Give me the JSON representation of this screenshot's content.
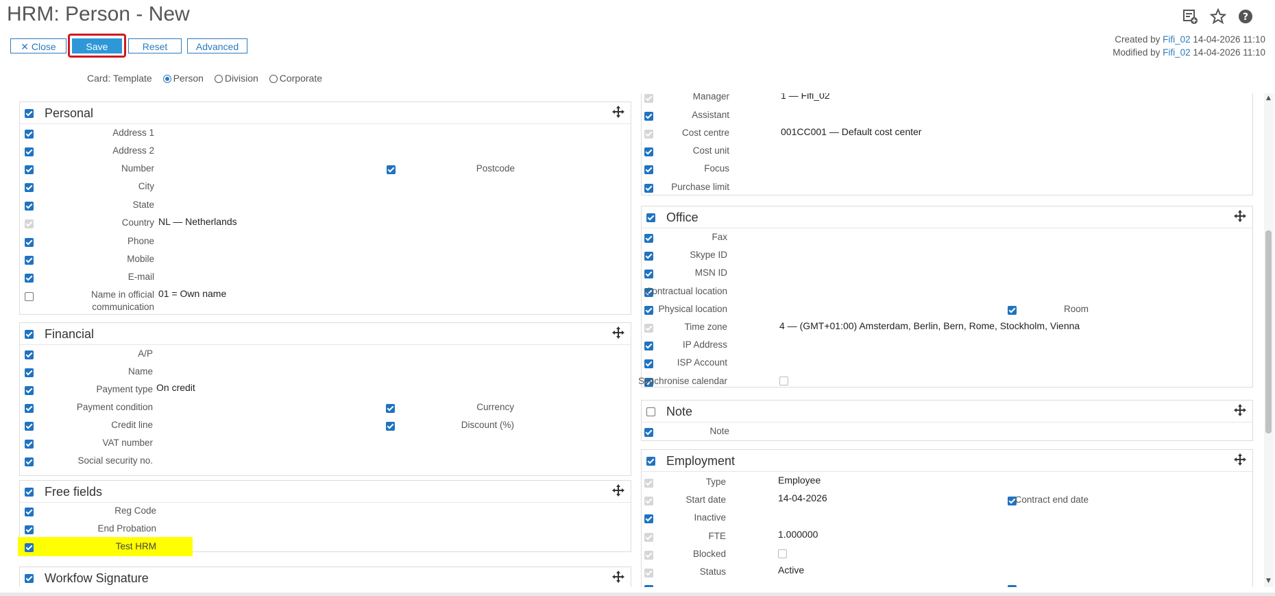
{
  "header": {
    "title": "HRM: Person - New",
    "buttons": {
      "close": "Close",
      "save": "Save",
      "reset": "Reset",
      "advanced": "Advanced"
    },
    "icons": [
      "list-add-icon",
      "star-icon",
      "help-icon"
    ],
    "created_label": "Created by",
    "created_user": "Fifi_02",
    "created_date": "14-04-2026 11:10",
    "modified_label": "Modified by",
    "modified_user": "Fifi_02",
    "modified_date": "14-04-2026 11:10"
  },
  "card": {
    "label": "Card: Template",
    "options": [
      "Person",
      "Division",
      "Corporate"
    ],
    "selected": "Person"
  },
  "left": {
    "personal": {
      "title": "Personal",
      "fields": {
        "address1": "Address 1",
        "address2": "Address 2",
        "number": "Number",
        "postcode": "Postcode",
        "city": "City",
        "state": "State",
        "country": "Country",
        "country_value": "NL — Netherlands",
        "phone": "Phone",
        "mobile": "Mobile",
        "email": "E-mail",
        "official_1": "Name in official",
        "official_2": "communication",
        "official_value": "01 = Own name"
      }
    },
    "financial": {
      "title": "Financial",
      "fields": {
        "ap": "A/P",
        "name": "Name",
        "payment_type": "Payment type",
        "payment_type_value": "On credit",
        "payment_condition": "Payment condition",
        "currency": "Currency",
        "credit_line": "Credit line",
        "discount": "Discount (%)",
        "vat": "VAT number",
        "ssn": "Social security no."
      }
    },
    "free": {
      "title": "Free fields",
      "fields": {
        "reg_code": "Reg Code",
        "end_probation": "End Probation",
        "test_hrm": "Test HRM"
      }
    },
    "workflow": {
      "title": "Workfow Signature"
    }
  },
  "right": {
    "top": {
      "manager": "Manager",
      "manager_value": "1 — Fifi_02",
      "assistant": "Assistant",
      "cost_centre": "Cost centre",
      "cost_centre_value": "001CC001 — Default cost center",
      "cost_unit": "Cost unit",
      "focus": "Focus",
      "purchase_limit": "Purchase limit"
    },
    "office": {
      "title": "Office",
      "fields": {
        "fax": "Fax",
        "skype": "Skype ID",
        "msn": "MSN ID",
        "contractual": "Contractual location",
        "physical": "Physical location",
        "room": "Room",
        "time_zone": "Time zone",
        "time_zone_value": "4 — (GMT+01:00) Amsterdam, Berlin, Bern, Rome, Stockholm, Vienna",
        "ip": "IP Address",
        "isp": "ISP Account",
        "sync": "Synchronise calendar"
      }
    },
    "note": {
      "title": "Note",
      "fields": {
        "note": "Note"
      }
    },
    "employment": {
      "title": "Employment",
      "fields": {
        "type": "Type",
        "type_value": "Employee",
        "start_date": "Start date",
        "start_date_value": "14-04-2026",
        "contract_end": "Contract end date",
        "inactive": "Inactive",
        "fte": "FTE",
        "fte_value": "1.000000",
        "blocked": "Blocked",
        "status": "Status",
        "status_value": "Active"
      }
    }
  },
  "colors": {
    "accent": "#2e97d8",
    "checkbox": "#1f73c1",
    "highlight": "#ffff00",
    "save_outline": "#d01822"
  }
}
